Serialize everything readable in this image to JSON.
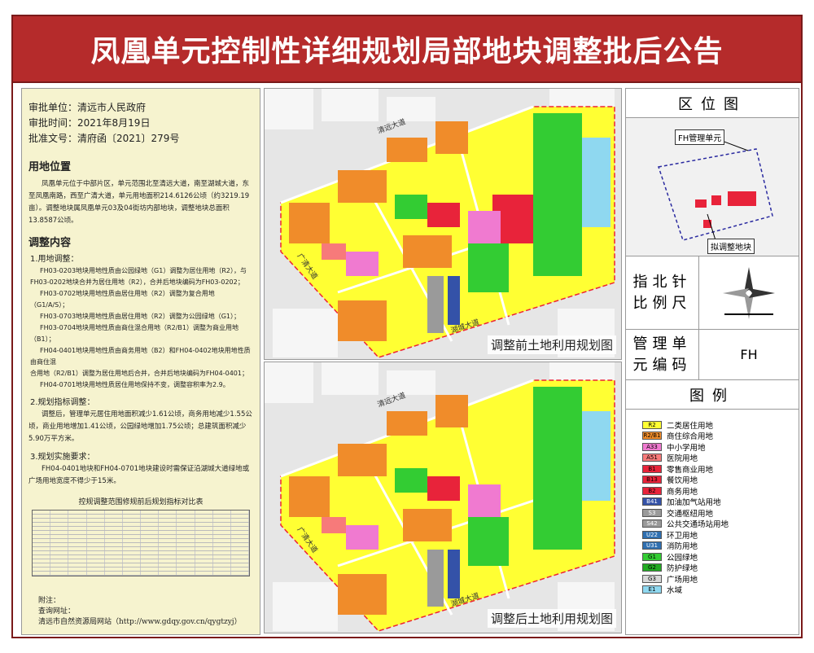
{
  "title": "凤凰单元控制性详细规划局部地块调整批后公告",
  "info": {
    "approver": "审批单位：清远市人民政府",
    "approve_date": "审批时间：2021年8月19日",
    "doc_no": "批准文号：清府函〔2021〕279号"
  },
  "location": {
    "heading": "用地位置",
    "text": "凤凰单元位于中部片区，单元范围北至清远大道，南至湖城大道，东至凤凰南路，西至广清大道，单元用地面积214.6126公顷（约3219.19亩）。调整地块属凤凰单元03及04街坊内部地块，调整地块总面积13.8587公顷。"
  },
  "adjust": {
    "heading": "调整内容",
    "sub1": "1.用地调整：",
    "items": [
      "FH03-0203地块用地性质由公园绿地（G1）调整为居住用地（R2），与",
      "FH03-0202地块合并为居住用地（R2），合并后地块编码为FH03-0202；",
      "FH03-0702地块用地性质由居住用地（R2）调整为复合用地（G1/A/S）；",
      "FH03-0703地块用地性质由居住用地（R2）调整为公园绿地（G1）；",
      "FH03-0704地块用地性质由商住混合用地（R2/B1）调整为商业用地（B1）；",
      "FH04-0401地块用地性质由商务用地（B2）和FH04-0402地块用地性质由商住混",
      "合用地（R2/B1）调整为居住用地后合并，合并后地块编码为FH04-0401；",
      "FH04-0701地块用地性质居住用地保持不变，调整容积率为2.9。"
    ],
    "sub2": "2.规划指标调整：",
    "indicator_text": "调整后，管理单元居住用地面积减少1.61公顷，商务用地减少1.55公顷，商业用地增加1.41公顷，公园绿地增加1.75公顷；总建筑面积减少5.90万平方米。",
    "sub3": "3.规划实施要求：",
    "require_text": "FH04-0401地块和FH04-0701地块建设时需保证沿湖城大道绿地或广场用地宽度不得少于15米。"
  },
  "table_title": "控规调整范围修规前后规划指标对比表",
  "footer": {
    "note": "附注：",
    "query": "查询网址：",
    "site": "清远市自然资源局网站（http://www.gdqy.gov.cn/qygtzyj）"
  },
  "maps": {
    "before_caption": "调整前土地利用规划图",
    "after_caption": "调整后土地利用规划图",
    "roads": {
      "north": "清远大道",
      "south": "湖城大道",
      "west": "广清大道"
    }
  },
  "right": {
    "location_heading": "区位图",
    "loc_label_top": "FH管理单元",
    "loc_label_bottom": "拟调整地块",
    "north_label": "指北针\n比例尺",
    "unit_label": "管理单元编码",
    "unit_code": "FH",
    "legend_heading": "图例"
  },
  "legend": [
    {
      "code": "R2",
      "label": "二类居住用地",
      "color": "#ffff33"
    },
    {
      "code": "R2/B1",
      "label": "商住综合用地",
      "color": "#f08c2a"
    },
    {
      "code": "A33",
      "label": "中小学用地",
      "color": "#f07ad0"
    },
    {
      "code": "A51",
      "label": "医院用地",
      "color": "#f77a7a"
    },
    {
      "code": "B1",
      "label": "零售商业用地",
      "color": "#e8233a"
    },
    {
      "code": "B13",
      "label": "餐饮用地",
      "color": "#e8233a"
    },
    {
      "code": "B2",
      "label": "商务用地",
      "color": "#e8233a"
    },
    {
      "code": "B41",
      "label": "加油加气站用地",
      "color": "#3452a8"
    },
    {
      "code": "S3",
      "label": "交通枢纽用地",
      "color": "#9a9a9a"
    },
    {
      "code": "S42",
      "label": "公共交通场站用地",
      "color": "#9a9a9a"
    },
    {
      "code": "U22",
      "label": "环卫用地",
      "color": "#2f6fb0"
    },
    {
      "code": "U31",
      "label": "消防用地",
      "color": "#2f6fb0"
    },
    {
      "code": "G1",
      "label": "公园绿地",
      "color": "#33cc33"
    },
    {
      "code": "G2",
      "label": "防护绿地",
      "color": "#22aa22"
    },
    {
      "code": "G3",
      "label": "广场用地",
      "color": "#d8d8d8"
    },
    {
      "code": "E1",
      "label": "水域",
      "color": "#8fd8f0"
    }
  ]
}
